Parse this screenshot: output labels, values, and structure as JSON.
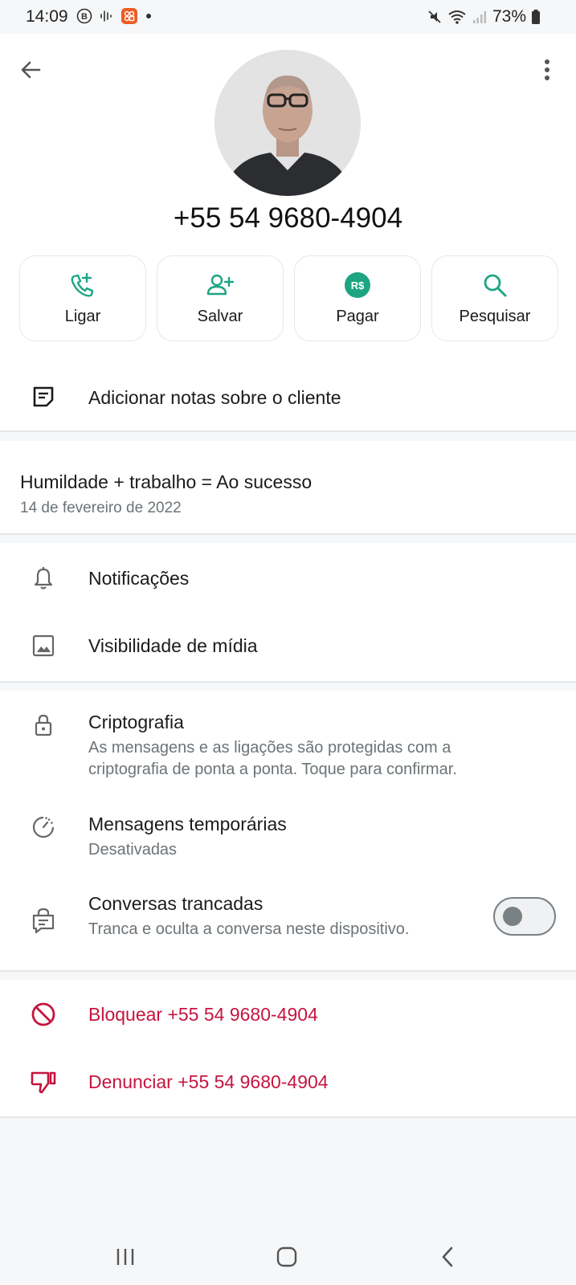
{
  "status_bar": {
    "time": "14:09",
    "battery": "73%",
    "icons": [
      "b-circle-icon",
      "voice-wave-icon",
      "app-badge-icon",
      "dot-icon",
      "mute-icon",
      "wifi-icon",
      "signal-icon",
      "battery-icon"
    ]
  },
  "header": {
    "phone_number": "+55 54 9680-4904"
  },
  "actions": [
    {
      "label": "Ligar",
      "icon": "call-add-icon"
    },
    {
      "label": "Salvar",
      "icon": "person-add-icon"
    },
    {
      "label": "Pagar",
      "icon": "real-currency-icon",
      "icon_text": "R$"
    },
    {
      "label": "Pesquisar",
      "icon": "search-icon"
    }
  ],
  "notes": {
    "label": "Adicionar notas sobre o cliente"
  },
  "about": {
    "text": "Humildade + trabalho = Ao sucesso",
    "date": "14 de fevereiro de 2022"
  },
  "settings": {
    "notifications": "Notificações",
    "media_visibility": "Visibilidade de mídia",
    "encryption_title": "Criptografia",
    "encryption_line1": "As mensagens e as ligações são protegidas com a",
    "encryption_line2": "criptografia de ponta a ponta. Toque para confirmar.",
    "temp_messages_title": "Mensagens temporárias",
    "temp_messages_sub": "Desativadas",
    "locked_chats_title": "Conversas trancadas",
    "locked_chats_sub": "Tranca e oculta a conversa neste dispositivo.",
    "locked_chats_enabled": false
  },
  "danger": {
    "block": "Bloquear +55 54 9680-4904",
    "report": "Denunciar +55 54 9680-4904"
  },
  "colors": {
    "accent": "#1da583",
    "danger": "#c5153f",
    "background": "#f6f7f8"
  }
}
